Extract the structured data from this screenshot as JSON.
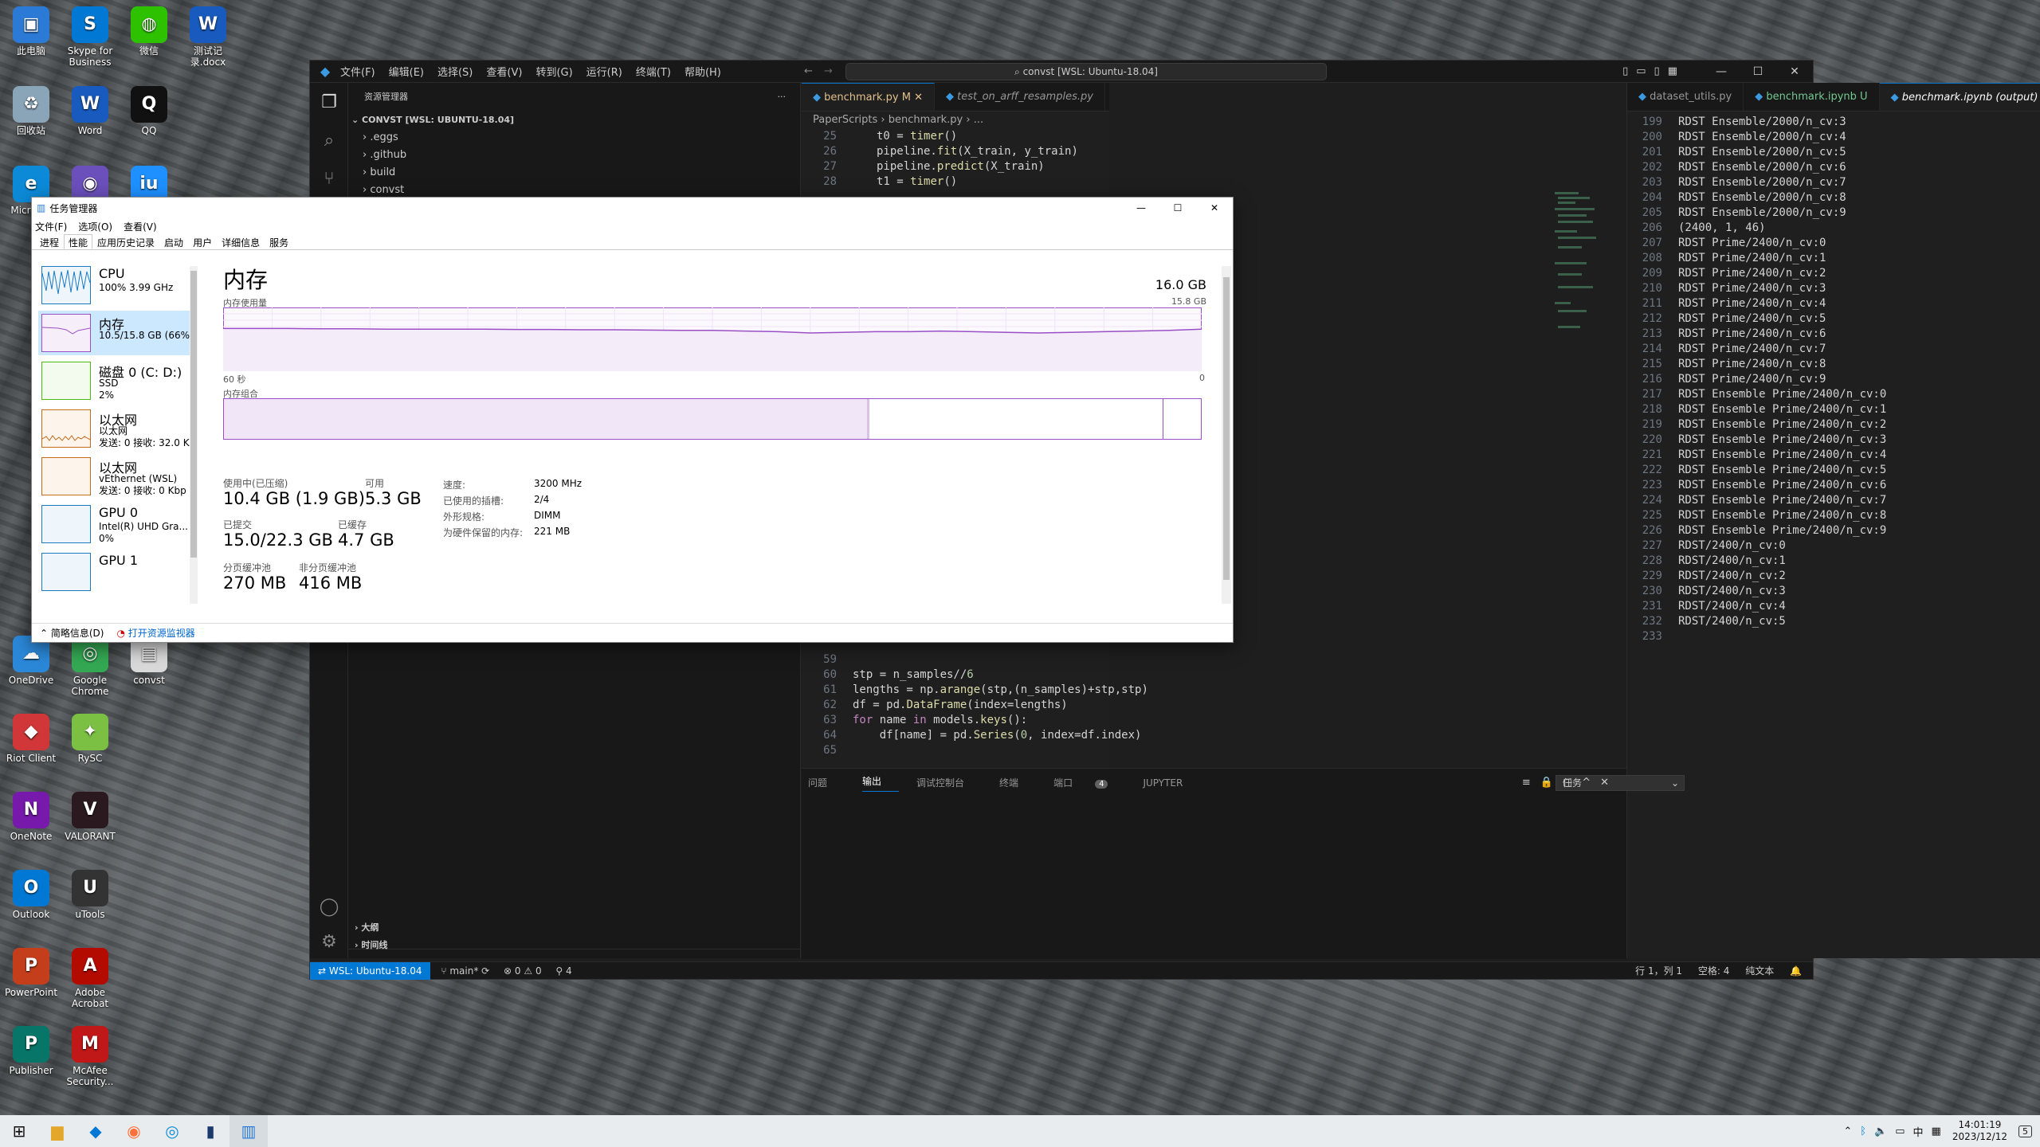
{
  "desktop": {
    "icons": [
      {
        "label": "此电脑",
        "color": "#2b7bd6",
        "glyph": "▣"
      },
      {
        "label": "Skype for Business",
        "color": "#0078d4",
        "glyph": "S"
      },
      {
        "label": "微信",
        "color": "#2dc100",
        "glyph": "◍"
      },
      {
        "label": "测试记录.docx",
        "color": "#185abd",
        "glyph": "W"
      },
      {
        "label": "回收站",
        "color": "#8aa4b8",
        "glyph": "♻"
      },
      {
        "label": "Word",
        "color": "#185abd",
        "glyph": "W"
      },
      {
        "label": "QQ",
        "color": "#111111",
        "glyph": "Q"
      },
      {
        "label": "Micro Ed",
        "color": "#0c8ad8",
        "glyph": "e"
      },
      {
        "label": "",
        "color": "#6b4fbb",
        "glyph": "◉"
      },
      {
        "label": "",
        "color": "#1e90ff",
        "glyph": "iu"
      },
      {
        "label": "OneDrive",
        "color": "#2b88d8",
        "glyph": "☁"
      },
      {
        "label": "Google Chrome",
        "color": "#34a853",
        "glyph": "◎"
      },
      {
        "label": "convst",
        "color": "#d9d9d9",
        "glyph": "▤"
      },
      {
        "label": "Riot Client",
        "color": "#d13639",
        "glyph": "◆"
      },
      {
        "label": "RySC",
        "color": "#7bc043",
        "glyph": "✦"
      },
      {
        "label": "OneNote",
        "color": "#7719aa",
        "glyph": "N"
      },
      {
        "label": "VALORANT",
        "color": "#2a1a1f",
        "glyph": "V"
      },
      {
        "label": "Outlook",
        "color": "#0078d4",
        "glyph": "O"
      },
      {
        "label": "uTools",
        "color": "#333333",
        "glyph": "U"
      },
      {
        "label": "PowerPoint",
        "color": "#c43e1c",
        "glyph": "P"
      },
      {
        "label": "Adobe Acrobat",
        "color": "#b30b00",
        "glyph": "A"
      },
      {
        "label": "Publisher",
        "color": "#077568",
        "glyph": "P"
      },
      {
        "label": "McAfee Security...",
        "color": "#c01818",
        "glyph": "M"
      }
    ]
  },
  "vscode": {
    "menu": [
      "文件(F)",
      "编辑(E)",
      "选择(S)",
      "查看(V)",
      "转到(G)",
      "运行(R)",
      "终端(T)",
      "帮助(H)"
    ],
    "search": "convst [WSL: Ubuntu-18.04]",
    "sidebar": {
      "header": "资源管理器",
      "root": "CONVST [WSL: UBUNTU-18.04]",
      "tree": [
        ".eggs",
        ".github",
        "build",
        "convst"
      ],
      "outline": "大纲",
      "timeline": "时间线"
    },
    "editor1": {
      "tabs": [
        "benchmark.py M",
        "test_on_arff_resamples.py"
      ],
      "breadcrumb": [
        "PaperScripts",
        "benchmark.py",
        "..."
      ],
      "lines_top": [
        {
          "n": "25",
          "text": "t0 = timer()"
        },
        {
          "n": "26",
          "text": "pipeline.fit(X_train, y_train)"
        },
        {
          "n": "27",
          "text": "pipeline.predict(X_train)"
        },
        {
          "n": "28",
          "text": "t1 = timer()"
        }
      ],
      "lines_bottom": [
        {
          "n": "59",
          "text": ""
        },
        {
          "n": "60",
          "text": "stp = n_samples//6"
        },
        {
          "n": "61",
          "text": "lengths = np.arange(stp,(n_samples)+stp,stp)"
        },
        {
          "n": "62",
          "text": "df = pd.DataFrame(index=lengths)"
        },
        {
          "n": "63",
          "text": "for name in models.keys():"
        },
        {
          "n": "64",
          "text": "    df[name] = pd.Series(0, index=df.index)"
        },
        {
          "n": "65",
          "text": ""
        }
      ]
    },
    "editor2": {
      "tabs": [
        "dataset_utils.py",
        "benchmark.ipynb U",
        "benchmark.ipynb (output)"
      ],
      "output": [
        {
          "n": "199",
          "text": "RDST Ensemble/2000/n_cv:3"
        },
        {
          "n": "200",
          "text": "RDST Ensemble/2000/n_cv:4"
        },
        {
          "n": "201",
          "text": "RDST Ensemble/2000/n_cv:5"
        },
        {
          "n": "202",
          "text": "RDST Ensemble/2000/n_cv:6"
        },
        {
          "n": "203",
          "text": "RDST Ensemble/2000/n_cv:7"
        },
        {
          "n": "204",
          "text": "RDST Ensemble/2000/n_cv:8"
        },
        {
          "n": "205",
          "text": "RDST Ensemble/2000/n_cv:9"
        },
        {
          "n": "206",
          "text": "(2400, 1, 46)"
        },
        {
          "n": "207",
          "text": "RDST Prime/2400/n_cv:0"
        },
        {
          "n": "208",
          "text": "RDST Prime/2400/n_cv:1"
        },
        {
          "n": "209",
          "text": "RDST Prime/2400/n_cv:2"
        },
        {
          "n": "210",
          "text": "RDST Prime/2400/n_cv:3"
        },
        {
          "n": "211",
          "text": "RDST Prime/2400/n_cv:4"
        },
        {
          "n": "212",
          "text": "RDST Prime/2400/n_cv:5"
        },
        {
          "n": "213",
          "text": "RDST Prime/2400/n_cv:6"
        },
        {
          "n": "214",
          "text": "RDST Prime/2400/n_cv:7"
        },
        {
          "n": "215",
          "text": "RDST Prime/2400/n_cv:8"
        },
        {
          "n": "216",
          "text": "RDST Prime/2400/n_cv:9"
        },
        {
          "n": "217",
          "text": "RDST Ensemble Prime/2400/n_cv:0"
        },
        {
          "n": "218",
          "text": "RDST Ensemble Prime/2400/n_cv:1"
        },
        {
          "n": "219",
          "text": "RDST Ensemble Prime/2400/n_cv:2"
        },
        {
          "n": "220",
          "text": "RDST Ensemble Prime/2400/n_cv:3"
        },
        {
          "n": "221",
          "text": "RDST Ensemble Prime/2400/n_cv:4"
        },
        {
          "n": "222",
          "text": "RDST Ensemble Prime/2400/n_cv:5"
        },
        {
          "n": "223",
          "text": "RDST Ensemble Prime/2400/n_cv:6"
        },
        {
          "n": "224",
          "text": "RDST Ensemble Prime/2400/n_cv:7"
        },
        {
          "n": "225",
          "text": "RDST Ensemble Prime/2400/n_cv:8"
        },
        {
          "n": "226",
          "text": "RDST Ensemble Prime/2400/n_cv:9"
        },
        {
          "n": "227",
          "text": "RDST/2400/n_cv:0"
        },
        {
          "n": "228",
          "text": "RDST/2400/n_cv:1"
        },
        {
          "n": "229",
          "text": "RDST/2400/n_cv:2"
        },
        {
          "n": "230",
          "text": "RDST/2400/n_cv:3"
        },
        {
          "n": "231",
          "text": "RDST/2400/n_cv:4"
        },
        {
          "n": "232",
          "text": "RDST/2400/n_cv:5"
        },
        {
          "n": "233",
          "text": ""
        }
      ]
    },
    "panel": {
      "tabs": [
        "问题",
        "输出",
        "调试控制台",
        "终端",
        "端口"
      ],
      "ports_badge": "4",
      "jupyter": "JUPYTER",
      "dropdown": "任务"
    },
    "status": {
      "remote": "WSL: Ubuntu-18.04",
      "branch": "main*",
      "errors": "0",
      "warnings": "0",
      "ports": "4",
      "position": "行 1，列 1",
      "spaces": "空格: 4",
      "language": "纯文本"
    }
  },
  "taskmgr": {
    "title": "任务管理器",
    "menu": [
      "文件(F)",
      "选项(O)",
      "查看(V)"
    ],
    "tabs": [
      "进程",
      "性能",
      "应用历史记录",
      "启动",
      "用户",
      "详细信息",
      "服务"
    ],
    "devices": [
      {
        "name": "CPU",
        "sub": "100% 3.99 GHz",
        "sub2": ""
      },
      {
        "name": "内存",
        "sub": "10.5/15.8 GB (66%)",
        "sub2": ""
      },
      {
        "name": "磁盘 0 (C: D:)",
        "sub": "SSD",
        "sub2": "2%"
      },
      {
        "name": "以太网",
        "sub": "以太网",
        "sub2": "发送: 0 接收: 32.0 K"
      },
      {
        "name": "以太网",
        "sub": "vEthernet (WSL)",
        "sub2": "发送: 0 接收: 0 Kbp"
      },
      {
        "name": "GPU 0",
        "sub": "Intel(R) UHD Gra...",
        "sub2": "0%"
      },
      {
        "name": "GPU 1",
        "sub": "",
        "sub2": ""
      }
    ],
    "memory": {
      "heading": "内存",
      "total": "16.0 GB",
      "usage_label": "内存使用量",
      "usage_max": "15.8 GB",
      "axis_left": "60 秒",
      "axis_right": "0",
      "composition_label": "内存组合",
      "in_use_label": "使用中(已压缩)",
      "in_use": "10.4 GB (1.9 GB)",
      "available_label": "可用",
      "available": "5.3 GB",
      "committed_label": "已提交",
      "committed": "15.0/22.3 GB",
      "cached_label": "已缓存",
      "cached": "4.7 GB",
      "paged_label": "分页缓冲池",
      "paged": "270 MB",
      "nonpaged_label": "非分页缓冲池",
      "nonpaged": "416 MB",
      "speed_label": "速度:",
      "speed": "3200 MHz",
      "slots_label": "已使用的插槽:",
      "slots": "2/4",
      "form_label": "外形规格:",
      "form": "DIMM",
      "reserved_label": "为硬件保留的内存:",
      "reserved": "221 MB",
      "usage_history": [
        0.67,
        0.67,
        0.67,
        0.665,
        0.665,
        0.66,
        0.66,
        0.66,
        0.66,
        0.655,
        0.655,
        0.65,
        0.65,
        0.645,
        0.64,
        0.64,
        0.63,
        0.62,
        0.6,
        0.61,
        0.62,
        0.62,
        0.63,
        0.62,
        0.61,
        0.6,
        0.61,
        0.62,
        0.63,
        0.64,
        0.66
      ]
    },
    "footer_less": "简略信息(D)",
    "footer_monitor": "打开资源监视器"
  },
  "taskbar": {
    "time": "14:01:19",
    "date": "2023/12/12",
    "ime": "中",
    "notif": "5"
  }
}
